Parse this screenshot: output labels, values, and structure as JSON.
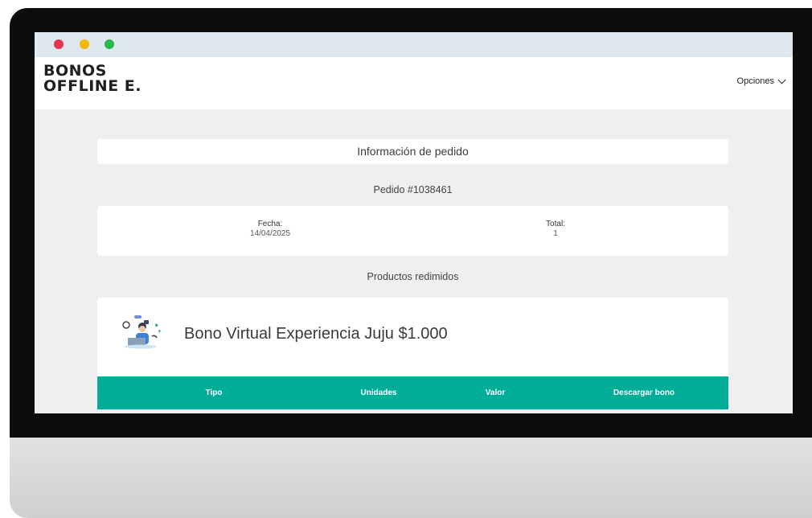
{
  "window": {
    "controls": [
      "close",
      "minimize",
      "maximize"
    ],
    "colors": {
      "close": "#e8334f",
      "minimize": "#f5b800",
      "maximize": "#2db84a"
    }
  },
  "header": {
    "logo_line1": "BONOS",
    "logo_line2": "OFFLINE E.",
    "options_label": "Opciones",
    "options_icon": "chevron-down-icon"
  },
  "order": {
    "section_title": "Información de pedido",
    "number": "Pedido #1038461",
    "fecha_label": "Fecha:",
    "fecha_value": "14/04/2025",
    "total_label": "Total:",
    "total_value": "1"
  },
  "products": {
    "section_title": "Productos redimidos",
    "items": [
      {
        "name": "Bono Virtual Experiencia Juju $1.000",
        "icon": "person-laptop-illustration-icon"
      }
    ],
    "table_headers": {
      "tipo": "Tipo",
      "unidades": "Unidades",
      "valor": "Valor",
      "descargar": "Descargar bono"
    }
  },
  "colors": {
    "accent": "#00ad97",
    "titlebar": "#dde8f1",
    "background": "#efefef"
  }
}
